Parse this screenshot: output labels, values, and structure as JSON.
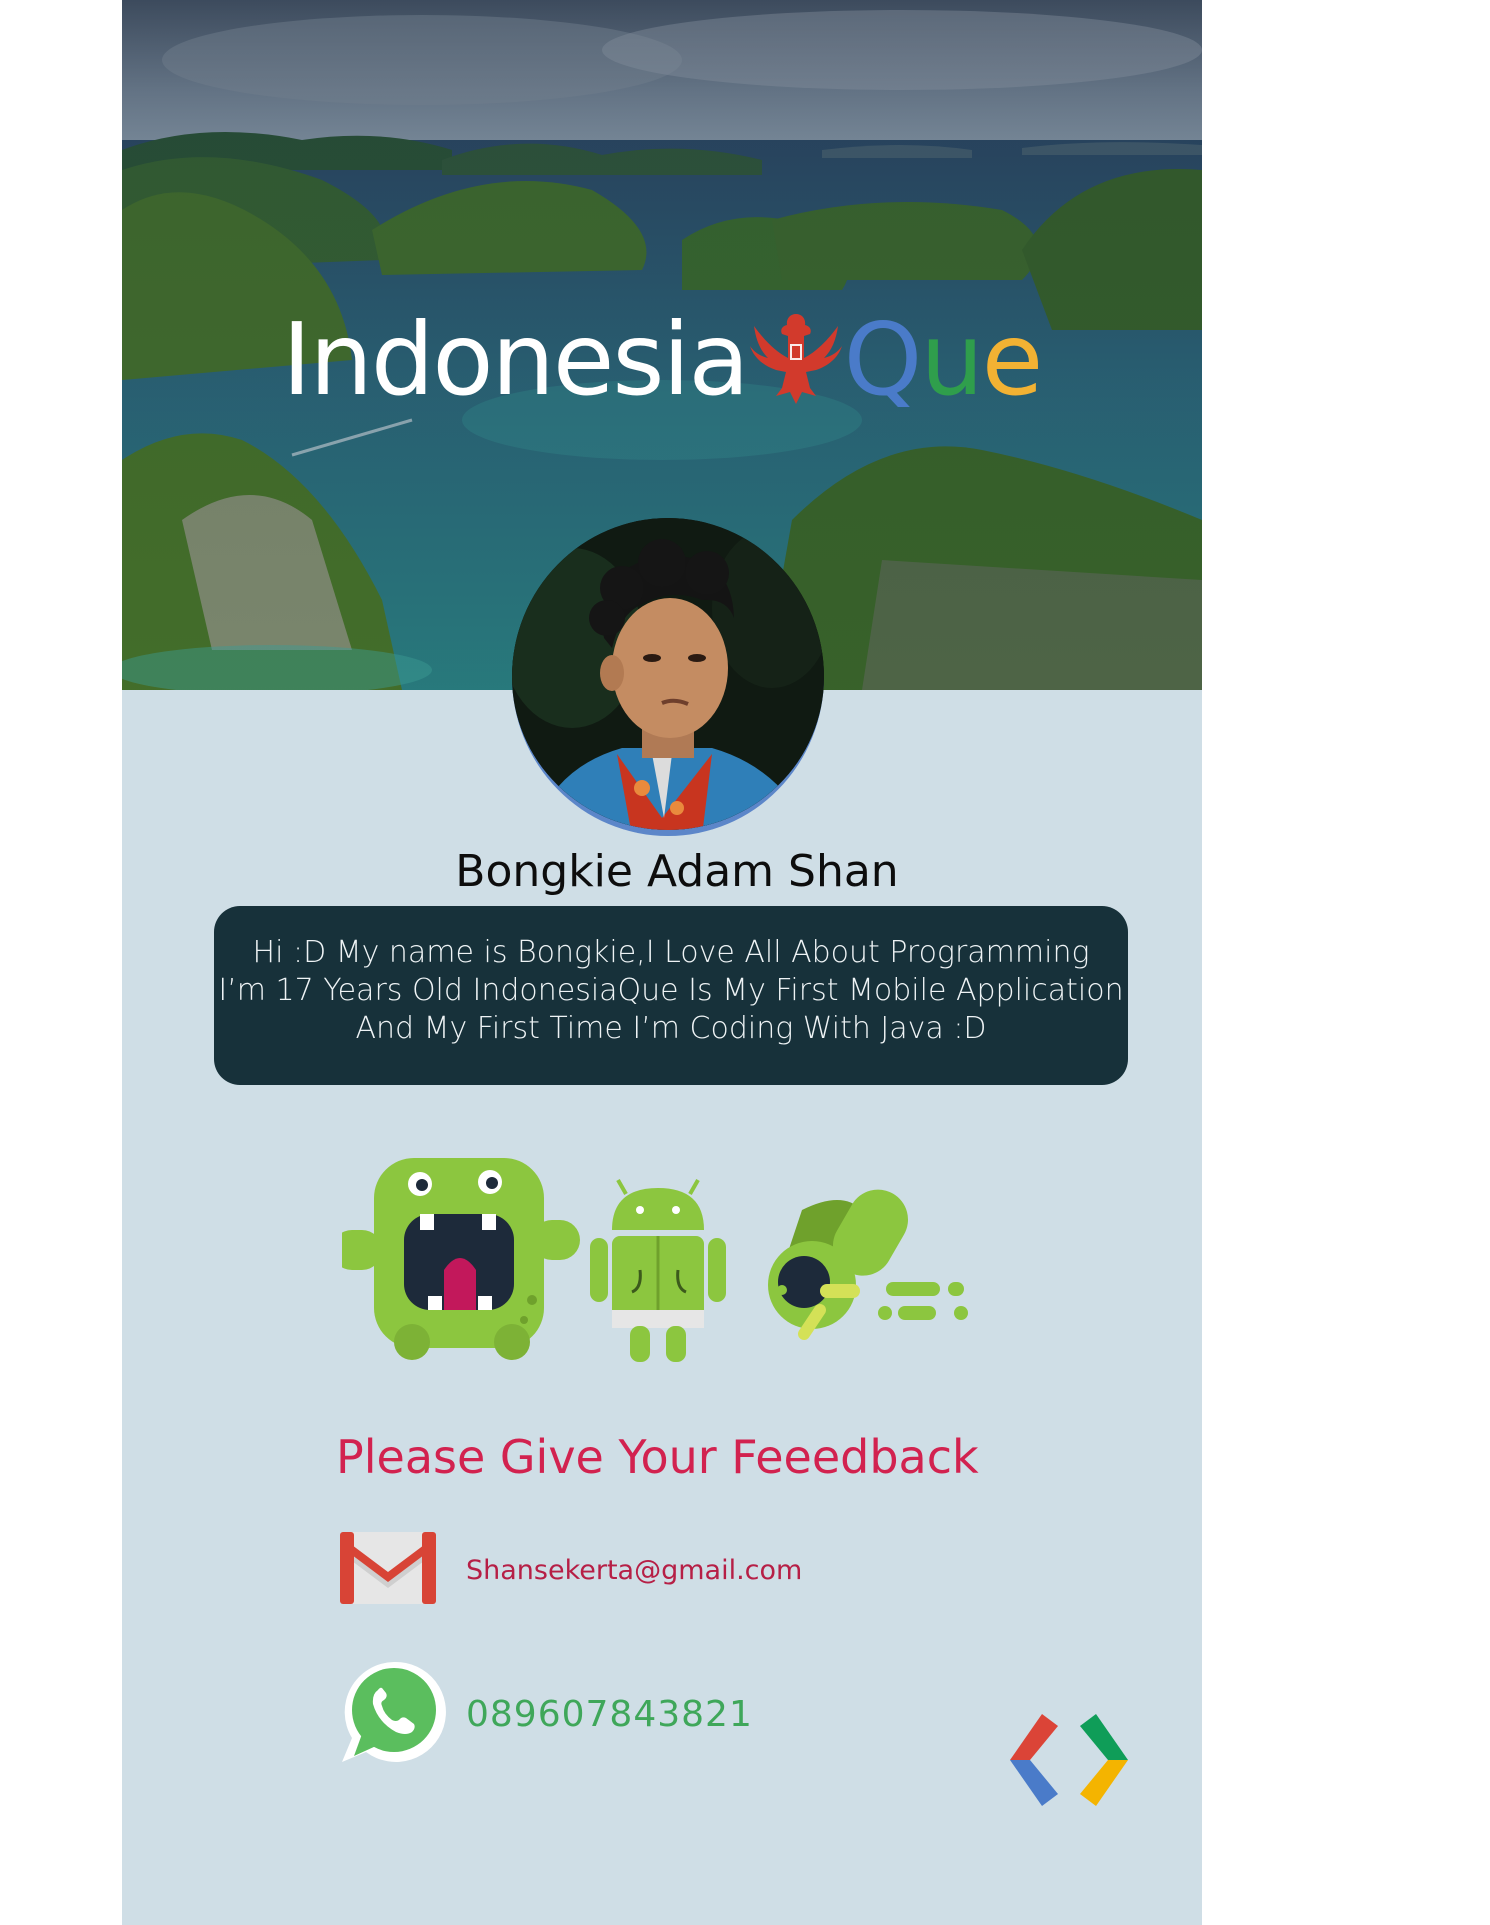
{
  "header": {
    "app_title_part1": "Indonesia",
    "app_title_part2": [
      "Q",
      "u",
      "e"
    ],
    "app_title_colors": [
      "#ffffff",
      "#4a7bc9",
      "#2f9e4c",
      "#f2b233"
    ],
    "emblem_icon": "garuda-emblem-icon",
    "emblem_color": "#d23a2c"
  },
  "profile": {
    "name": "Bongkie Adam Shan",
    "bio_lines": [
      "Hi :D My name is Bongkie,I Love All About Programming",
      "I’m 17 Years Old IndonesiaQue Is My First Mobile Application",
      "And My First Time I’m Coding With Java :D"
    ]
  },
  "feedback": {
    "title": "Please Give Your Feeedback",
    "title_color": "#d2224f",
    "email": "Shansekerta@gmail.com",
    "email_icon": "gmail-icon",
    "phone": "089607843821",
    "phone_icon": "whatsapp-icon"
  },
  "decor": {
    "mascot_icons": [
      "green-monster-icon",
      "android-robot-icon",
      "green-rocket-creature-icon"
    ],
    "dev_logo_icon": "google-developers-logo-icon"
  }
}
